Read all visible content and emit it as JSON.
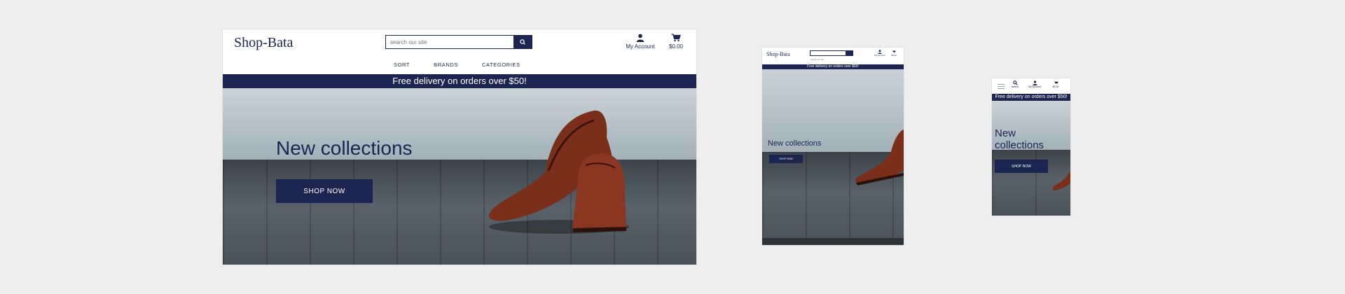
{
  "brand": "Shop-Bata",
  "colors": {
    "primary": "#1c2550",
    "background": "#efeeee",
    "white": "#ffffff"
  },
  "search": {
    "placeholder": "search our site",
    "icon": "search-icon"
  },
  "utility": {
    "account_label": "My Account",
    "cart_total": "$0.00",
    "search_label": "search"
  },
  "nav": [
    "SORT",
    "BRANDS",
    "CATEGORIES"
  ],
  "banner": "Free delivery on orders over $50!",
  "hero": {
    "title": "New collections",
    "cta": "SHOP NOW"
  },
  "mobile": {
    "banner_visible": "Free delivery on orders over $50!"
  }
}
